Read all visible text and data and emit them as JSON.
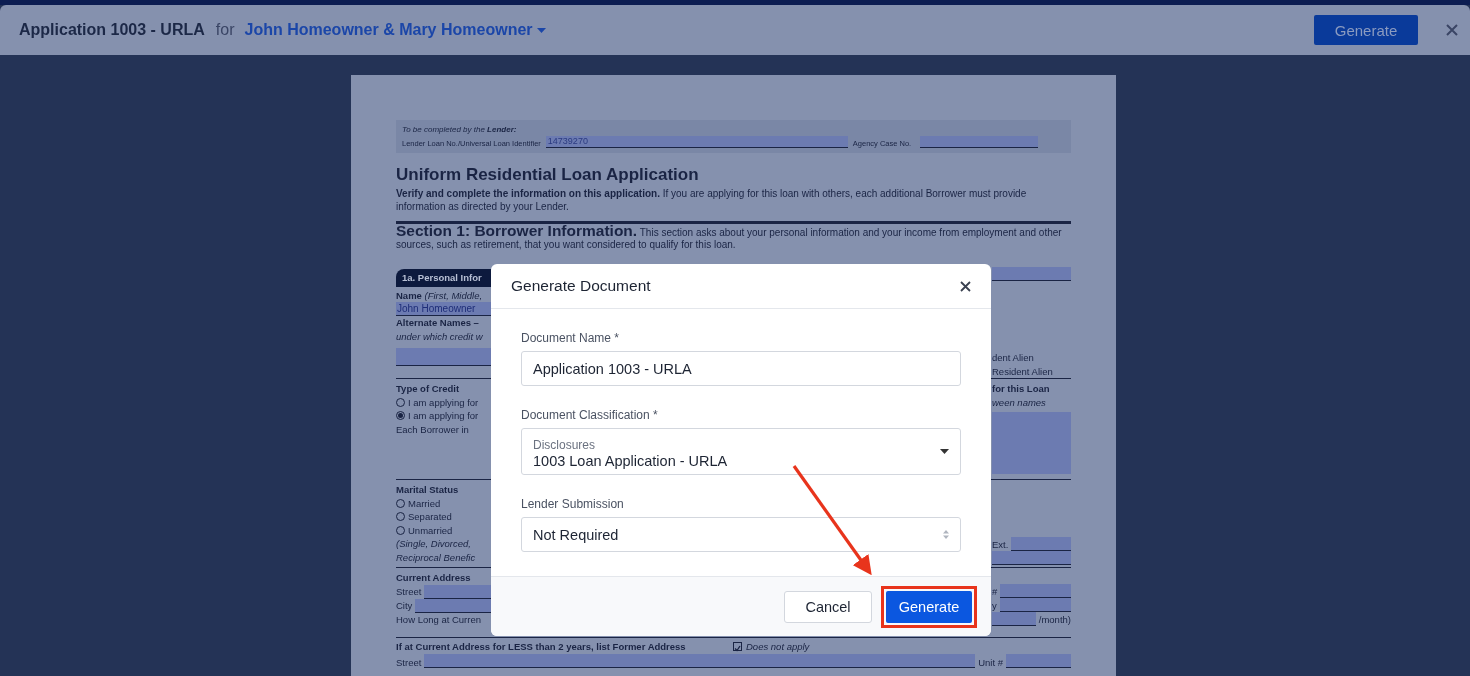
{
  "header": {
    "title": "Application 1003 - URLA",
    "connector": "for",
    "borrowers": "John Homeowner & Mary Homeowner",
    "generate_button": "Generate"
  },
  "document": {
    "lender_box": {
      "note": "To be completed by the **Lender:**",
      "loan_id_label": "Lender Loan No./Universal Loan Identifier",
      "loan_id": "14739270",
      "agency_label": "Agency Case No."
    },
    "title": "Uniform Residential Loan Application",
    "intro": "**Verify and complete the information on this application.** If you are applying for this loan with others, each additional Borrower must provide information as directed by your Lender.",
    "section_title": "Section 1: Borrower Information.",
    "section_text": "This section asks about your personal information and your income from employment and other sources, such as retirement, that you want considered to qualify for this loan.",
    "blocks": [
      {
        "left": [
          {
            "kind": "heading",
            "text": "1a. Personal Infor"
          },
          {
            "kind": "rich",
            "text": "**Name** *(First, Middle,*"
          },
          {
            "kind": "field",
            "value": "John Homeowner"
          },
          {
            "kind": "label",
            "text": "Alternate Names –"
          },
          {
            "kind": "note",
            "text": "under which credit w"
          },
          {
            "kind": "field"
          }
        ],
        "right": [
          {
            "kind": "field"
          },
          {
            "kind": "text",
            "text": "dent Alien"
          },
          {
            "kind": "text",
            "text": "Resident Alien"
          }
        ]
      },
      {
        "left": [
          {
            "kind": "label",
            "text": "Type of Credit"
          },
          {
            "kind": "radio",
            "text": "I am applying for",
            "selected": false
          },
          {
            "kind": "radio",
            "text": "I am applying for",
            "selected": true
          },
          {
            "kind": "text",
            "text": "Each Borrower in"
          }
        ],
        "right": [
          {
            "kind": "label",
            "text": "for this Loan"
          },
          {
            "kind": "note",
            "text": "ween names"
          },
          {
            "kind": "area"
          }
        ]
      },
      {
        "left": [
          {
            "kind": "label",
            "text": "Marital Status"
          },
          {
            "kind": "radio",
            "text": "Married",
            "selected": false
          },
          {
            "kind": "radio",
            "text": "Separated",
            "selected": false
          },
          {
            "kind": "radio",
            "text": "Unmarried",
            "selected": false
          },
          {
            "kind": "note",
            "text": "(Single, Divorced,"
          },
          {
            "kind": "note",
            "text": "Reciprocal Benefic"
          }
        ],
        "right": [
          {
            "kind": "labeled_field",
            "text": "Ext."
          },
          {
            "kind": "field"
          }
        ]
      },
      {
        "left": [
          {
            "kind": "label",
            "text": "Current Address"
          },
          {
            "kind": "labeled_field",
            "text": "Street"
          },
          {
            "kind": "labeled_field",
            "text": "City"
          },
          {
            "kind": "text",
            "text": "How Long at Curren"
          }
        ],
        "right": [
          {
            "kind": "labeled_field",
            "text": "#"
          },
          {
            "kind": "labeled_field",
            "text": "y"
          },
          {
            "kind": "field_suffix",
            "text": "/month)"
          }
        ]
      }
    ],
    "former_address": {
      "label": "If at Current Address for LESS than 2 years, list Former Address",
      "checkbox_label": "Does not apply",
      "checked": true,
      "street_label": "Street",
      "unit_label": "Unit #"
    }
  },
  "modal": {
    "title": "Generate Document",
    "name_label": "Document Name *",
    "name_value": "Application 1003 - URLA",
    "classification_label": "Document Classification *",
    "classification_group": "Disclosures",
    "classification_value": "1003 Loan Application - URLA",
    "submission_label": "Lender Submission",
    "submission_value": "Not Required",
    "cancel_button": "Cancel",
    "generate_button": "Generate"
  }
}
